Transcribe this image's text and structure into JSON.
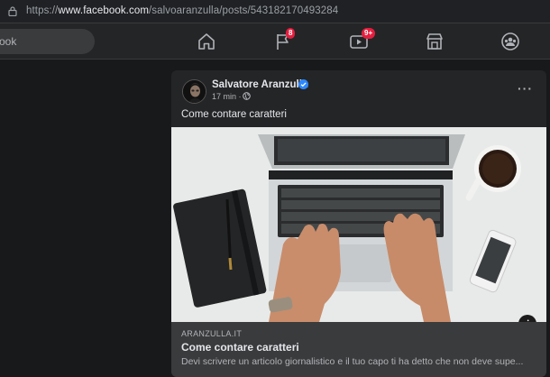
{
  "browser": {
    "url_prefix": "https://",
    "url_domain": "www.facebook.com",
    "url_path": "/salvoaranzulla/posts/543182170493284"
  },
  "nav": {
    "search_placeholder": "ook",
    "notifications_badge": "8",
    "video_badge": "9+"
  },
  "post": {
    "author": "Salvatore Aranzulla",
    "time": "17 min",
    "separator": "·",
    "more": "···",
    "caption": "Come contare caratteri",
    "link": {
      "domain": "ARANZULLA.IT",
      "title": "Come contare caratteri",
      "description": "Devi scrivere un articolo giornalistico e il tuo capo ti ha detto che non deve supe..."
    },
    "info_label": "i"
  },
  "colors": {
    "background": "#18191a",
    "surface": "#242526",
    "accent": "#2d88ff",
    "badge": "#e41e3f"
  }
}
